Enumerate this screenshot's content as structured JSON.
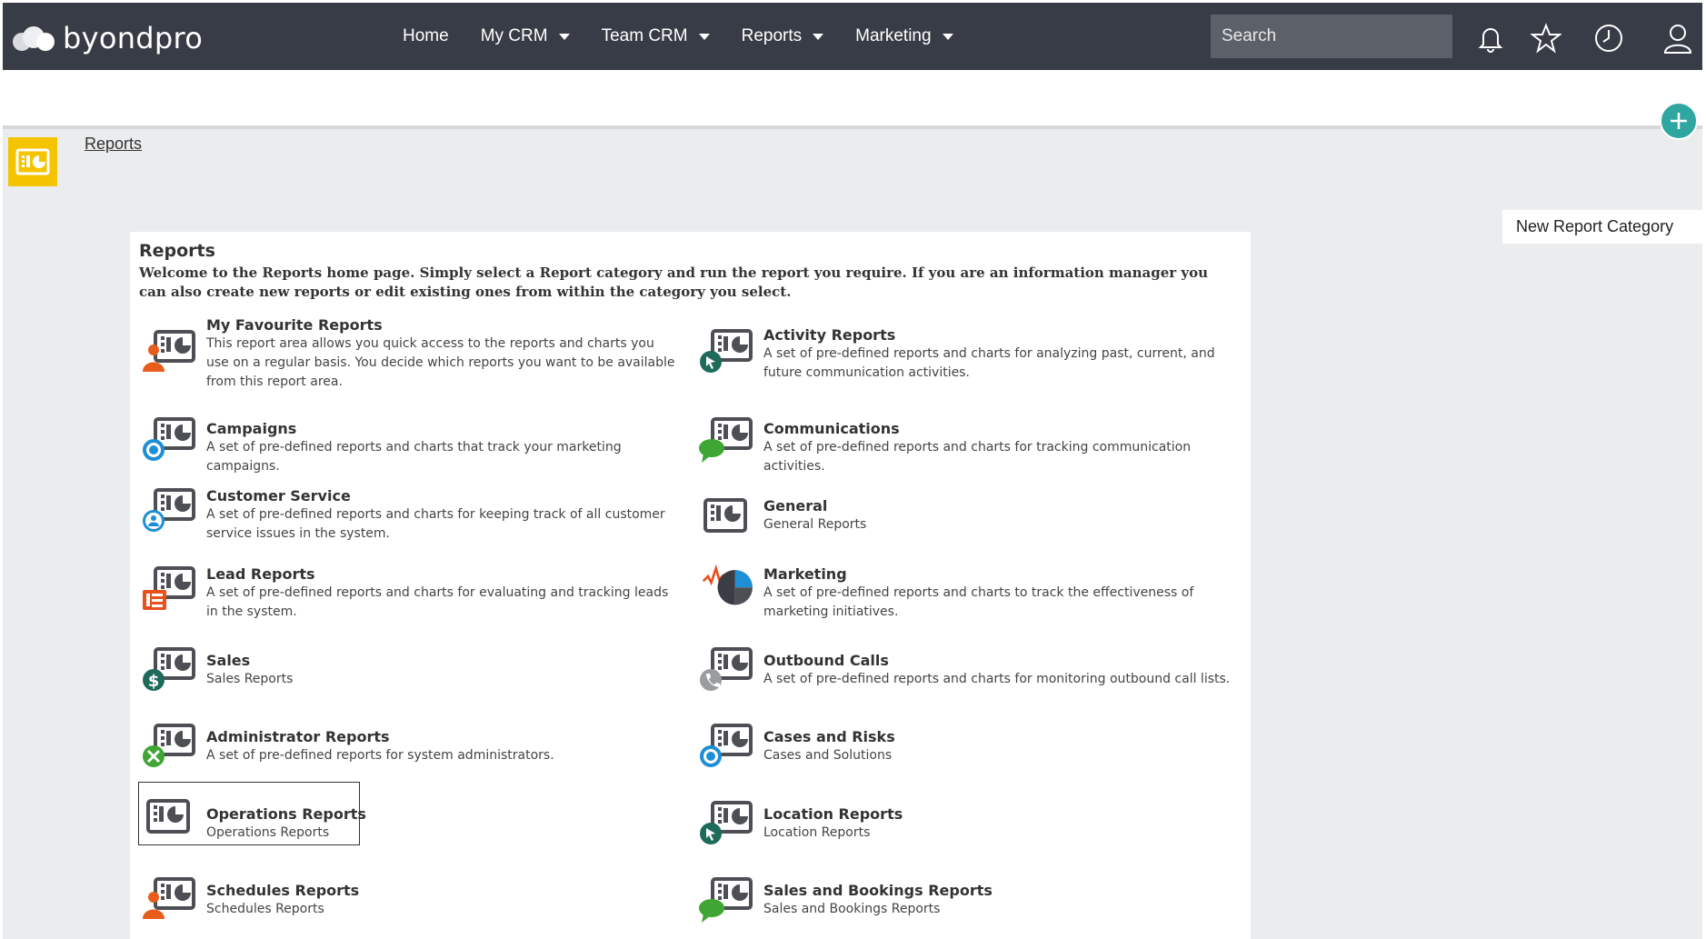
{
  "app": {
    "logo_text": "byondpro"
  },
  "nav": {
    "items": [
      {
        "label": "Home",
        "has_dropdown": false
      },
      {
        "label": "My CRM",
        "has_dropdown": true
      },
      {
        "label": "Team CRM",
        "has_dropdown": true
      },
      {
        "label": "Reports",
        "has_dropdown": true
      },
      {
        "label": "Marketing",
        "has_dropdown": true
      }
    ],
    "search_placeholder": "Search",
    "icons": [
      "bell-icon",
      "star-icon",
      "clock-icon",
      "user-icon"
    ]
  },
  "colors": {
    "topbar": "#383c46",
    "accent_teal": "#2fa7a0",
    "badge_yellow": "#f5c400",
    "page_gray": "#ebecee"
  },
  "page": {
    "breadcrumb": "Reports",
    "new_category_button": "New Report Category"
  },
  "panel": {
    "title": "Reports",
    "intro": "Welcome to the Reports home page. Simply select a Report category and run the report you require. If you are an information manager you can also create new reports or edit existing ones from within the category you select."
  },
  "categories": [
    {
      "name": "My Favourite Reports",
      "desc": "This report area allows you quick access to the reports and charts you use on a regular basis. You decide which reports you want to be available from this report area.",
      "icon": "favourite-reports-icon"
    },
    {
      "name": "Activity Reports",
      "desc": "A set of pre-defined reports and charts for analyzing past, current, and future communication activities.",
      "icon": "activity-reports-icon"
    },
    {
      "name": "Campaigns",
      "desc": "A set of pre-defined reports and charts that track your marketing campaigns.",
      "icon": "campaigns-icon"
    },
    {
      "name": "Communications",
      "desc": "A set of pre-defined reports and charts for tracking communication activities.",
      "icon": "communications-icon"
    },
    {
      "name": "Customer Service",
      "desc": "A set of pre-defined reports and charts for keeping track of all customer service issues in the system.",
      "icon": "customer-service-icon"
    },
    {
      "name": "General",
      "desc": "General Reports",
      "icon": "general-reports-icon"
    },
    {
      "name": "Lead Reports",
      "desc": "A set of pre-defined reports and charts for evaluating and tracking leads in the system.",
      "icon": "lead-reports-icon"
    },
    {
      "name": "Marketing",
      "desc": "A set of pre-defined reports and charts to track the effectiveness of marketing initiatives.",
      "icon": "marketing-chart-icon"
    },
    {
      "name": "Sales",
      "desc": "Sales Reports",
      "icon": "sales-reports-icon"
    },
    {
      "name": "Outbound Calls",
      "desc": "A set of pre-defined reports and charts for monitoring outbound call lists.",
      "icon": "outbound-calls-icon"
    },
    {
      "name": "Administrator Reports",
      "desc": "A set of pre-defined reports for system administrators.",
      "icon": "administrator-reports-icon"
    },
    {
      "name": "Cases and Risks",
      "desc": "Cases and Solutions",
      "icon": "cases-risks-icon"
    },
    {
      "name": "Operations Reports",
      "desc": "Operations Reports",
      "icon": "operations-reports-icon",
      "selected": true
    },
    {
      "name": "Location Reports",
      "desc": "Location Reports",
      "icon": "location-reports-icon"
    },
    {
      "name": "Schedules Reports",
      "desc": "Schedules Reports",
      "icon": "schedules-reports-icon"
    },
    {
      "name": "Sales and Bookings Reports",
      "desc": "Sales and Bookings Reports",
      "icon": "sales-bookings-icon"
    }
  ]
}
